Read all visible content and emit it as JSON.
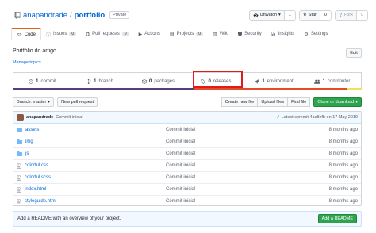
{
  "repo": {
    "owner": "anapandrade",
    "separator": "/",
    "name": "portfolio",
    "visibility": "Private"
  },
  "actions": {
    "watch": {
      "label": "Unwatch",
      "count": "1"
    },
    "star": {
      "label": "Star",
      "count": "0"
    },
    "fork": {
      "label": "Fork",
      "count": "0"
    }
  },
  "tabs": [
    {
      "label": "Code",
      "icon": "code-icon"
    },
    {
      "label": "Issues",
      "count": "0",
      "icon": "issue-icon"
    },
    {
      "label": "Pull requests",
      "count": "0",
      "icon": "pull-request-icon"
    },
    {
      "label": "Actions",
      "icon": "play-icon"
    },
    {
      "label": "Projects",
      "count": "0",
      "icon": "project-icon"
    },
    {
      "label": "Wiki",
      "icon": "book-icon"
    },
    {
      "label": "Security",
      "icon": "shield-icon"
    },
    {
      "label": "Insights",
      "icon": "graph-icon"
    },
    {
      "label": "Settings",
      "icon": "gear-icon"
    }
  ],
  "description": "Portfólio do artigo",
  "manage_topics": "Manage topics",
  "edit_label": "Edit",
  "summary": {
    "commits": {
      "num": "1",
      "label": "commit"
    },
    "branches": {
      "num": "1",
      "label": "branch"
    },
    "packages": {
      "num": "0",
      "label": "packages"
    },
    "releases": {
      "num": "0",
      "label": "releases"
    },
    "environments": {
      "num": "1",
      "label": "environment"
    },
    "contributors": {
      "num": "1",
      "label": "contributor"
    }
  },
  "language_colors": [
    "#563d7c",
    "#e34c26",
    "#f1e05a"
  ],
  "language_shares": [
    0.52,
    0.44,
    0.04
  ],
  "toolbar": {
    "branch_label": "Branch: master",
    "new_pr": "New pull request",
    "create_file": "Create new file",
    "upload_files": "Upload files",
    "find_file": "Find file",
    "clone": "Clone or download"
  },
  "latest_commit": {
    "author": "anapandrade",
    "message": "Commit inicial",
    "info": "Latest commit 4ac8efb on 17 May 2019"
  },
  "files": [
    {
      "name": "assets",
      "type": "dir",
      "message": "Commit inicial",
      "age": "8 months ago"
    },
    {
      "name": "img",
      "type": "dir",
      "message": "Commit inicial",
      "age": "8 months ago"
    },
    {
      "name": "js",
      "type": "dir",
      "message": "Commit inicial",
      "age": "8 months ago"
    },
    {
      "name": "colorful.css",
      "type": "file",
      "message": "Commit inicial",
      "age": "8 months ago"
    },
    {
      "name": "colorful.scss",
      "type": "file",
      "message": "Commit inicial",
      "age": "8 months ago"
    },
    {
      "name": "index.html",
      "type": "file",
      "message": "Commit inicial",
      "age": "8 months ago"
    },
    {
      "name": "styleguide.html",
      "type": "file",
      "message": "Commit inicial",
      "age": "8 months ago"
    }
  ],
  "readme": {
    "text": "Add a README with an overview of your project.",
    "button": "Add a README"
  },
  "colors": {
    "accent": "#0366d6",
    "green": "#2ea44f",
    "highlight": "#e01b1b",
    "tab_active": "#e36209"
  }
}
